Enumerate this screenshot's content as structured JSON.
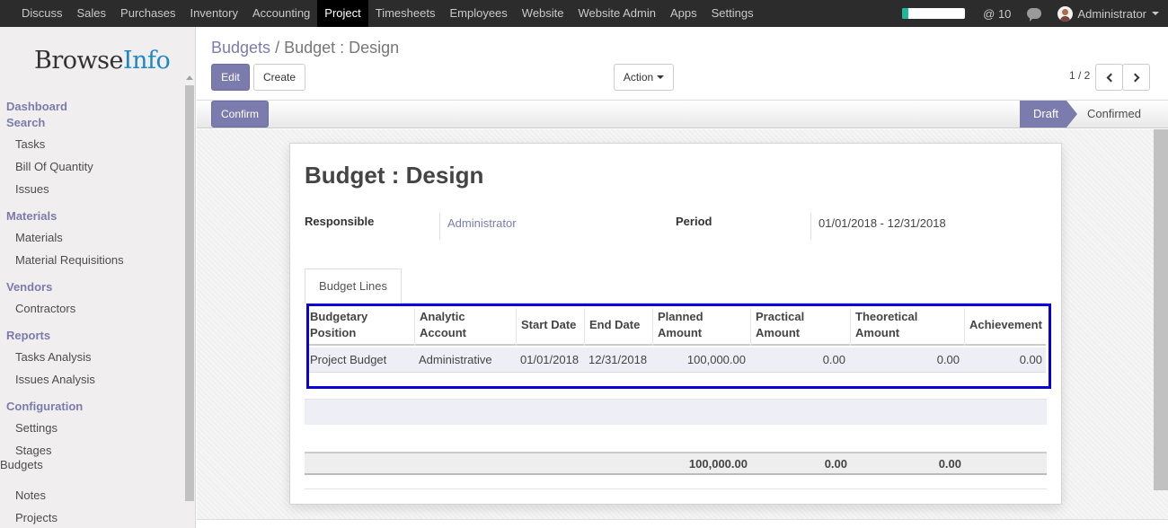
{
  "topnav": {
    "menus": [
      "Discuss",
      "Sales",
      "Purchases",
      "Inventory",
      "Accounting",
      "Project",
      "Timesheets",
      "Employees",
      "Website",
      "Website Admin",
      "Apps",
      "Settings"
    ],
    "active": "Project",
    "progress_fraction": 0.1,
    "messages": "@ 10",
    "user": "Administrator"
  },
  "sidebar": {
    "logo_part1": "Browse",
    "logo_part2": "Info",
    "sections": {
      "dashboard": "Dashboard",
      "search": "Search",
      "materials": "Materials",
      "vendors": "Vendors",
      "reports": "Reports",
      "configuration": "Configuration"
    },
    "items": {
      "tasks": "Tasks",
      "boq": "Bill Of Quantity",
      "issues": "Issues",
      "materials": "Materials",
      "material_requisitions": "Material Requisitions",
      "contractors": "Contractors",
      "tasks_analysis": "Tasks Analysis",
      "issues_analysis": "Issues Analysis",
      "settings": "Settings",
      "stages": "Stages",
      "budgets": "Budgets",
      "notes": "Notes",
      "projects": "Projects"
    }
  },
  "breadcrumb": {
    "parent": "Budgets",
    "separator": "/",
    "current": "Budget : Design"
  },
  "buttons": {
    "edit": "Edit",
    "create": "Create",
    "action": "Action",
    "confirm": "Confirm"
  },
  "pager": "1 / 2",
  "status": {
    "draft": "Draft",
    "confirmed": "Confirmed"
  },
  "form": {
    "title": "Budget : Design",
    "responsible_label": "Responsible",
    "responsible_value": "Administrator",
    "period_label": "Period",
    "period_value": "01/01/2018 - 12/31/2018",
    "tab": "Budget Lines"
  },
  "table": {
    "headers": {
      "budgetary_position_1": "Budgetary",
      "budgetary_position_2": "Position",
      "analytic_account_1": "Analytic",
      "analytic_account_2": "Account",
      "start_date": "Start Date",
      "end_date": "End Date",
      "planned_amount_1": "Planned",
      "planned_amount_2": "Amount",
      "practical_amount_1": "Practical",
      "practical_amount_2": "Amount",
      "theoretical_amount_1": "Theoretical",
      "theoretical_amount_2": "Amount",
      "achievement": "Achievement"
    },
    "rows": [
      {
        "budgetary_position": "Project Budget",
        "analytic_account": "Administrative",
        "start_date": "01/01/2018",
        "end_date": "12/31/2018",
        "planned_amount": "100,000.00",
        "practical_amount": "0.00",
        "theoretical_amount": "0.00",
        "achievement": "0.00"
      }
    ],
    "totals": {
      "planned_amount": "100,000.00",
      "practical_amount": "0.00",
      "theoretical_amount": "0.00"
    }
  }
}
